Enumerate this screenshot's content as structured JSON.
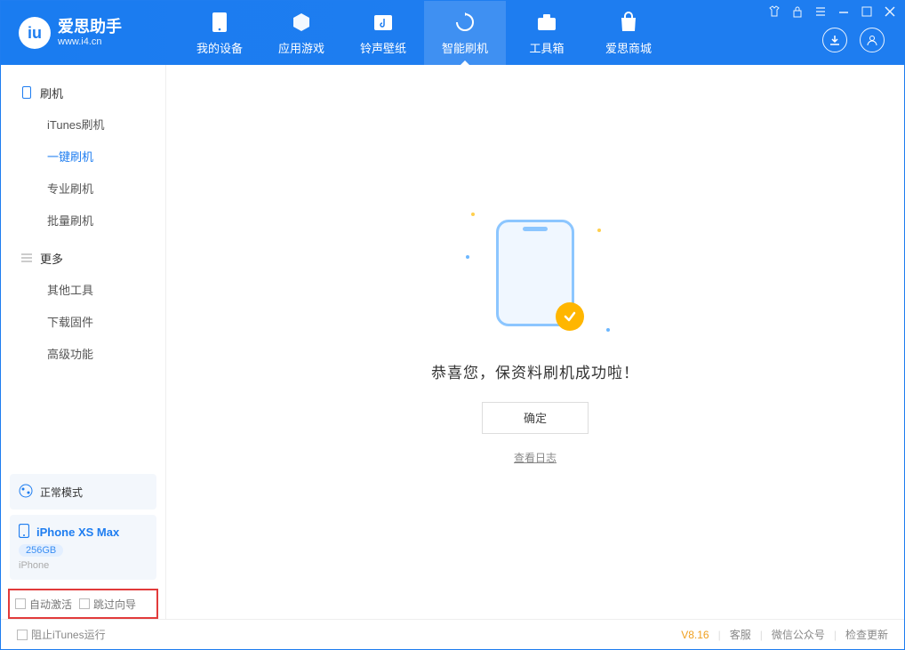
{
  "app": {
    "name": "爱思助手",
    "domain": "www.i4.cn"
  },
  "tabs": {
    "device": "我的设备",
    "apps": "应用游戏",
    "ringtones": "铃声壁纸",
    "flash": "智能刷机",
    "toolbox": "工具箱",
    "store": "爱思商城"
  },
  "sidebar": {
    "section_flash": "刷机",
    "items_flash": {
      "itunes": "iTunes刷机",
      "oneclick": "一键刷机",
      "pro": "专业刷机",
      "batch": "批量刷机"
    },
    "section_more": "更多",
    "items_more": {
      "other": "其他工具",
      "firmware": "下载固件",
      "advanced": "高级功能"
    }
  },
  "device": {
    "mode": "正常模式",
    "name": "iPhone XS Max",
    "capacity": "256GB",
    "type": "iPhone"
  },
  "highlight": {
    "auto_activate": "自动激活",
    "skip_guide": "跳过向导"
  },
  "main": {
    "success_msg": "恭喜您，保资料刷机成功啦！",
    "ok": "确定",
    "log": "查看日志"
  },
  "footer": {
    "block_itunes": "阻止iTunes运行",
    "version": "V8.16",
    "service": "客服",
    "wechat": "微信公众号",
    "update": "检查更新"
  }
}
